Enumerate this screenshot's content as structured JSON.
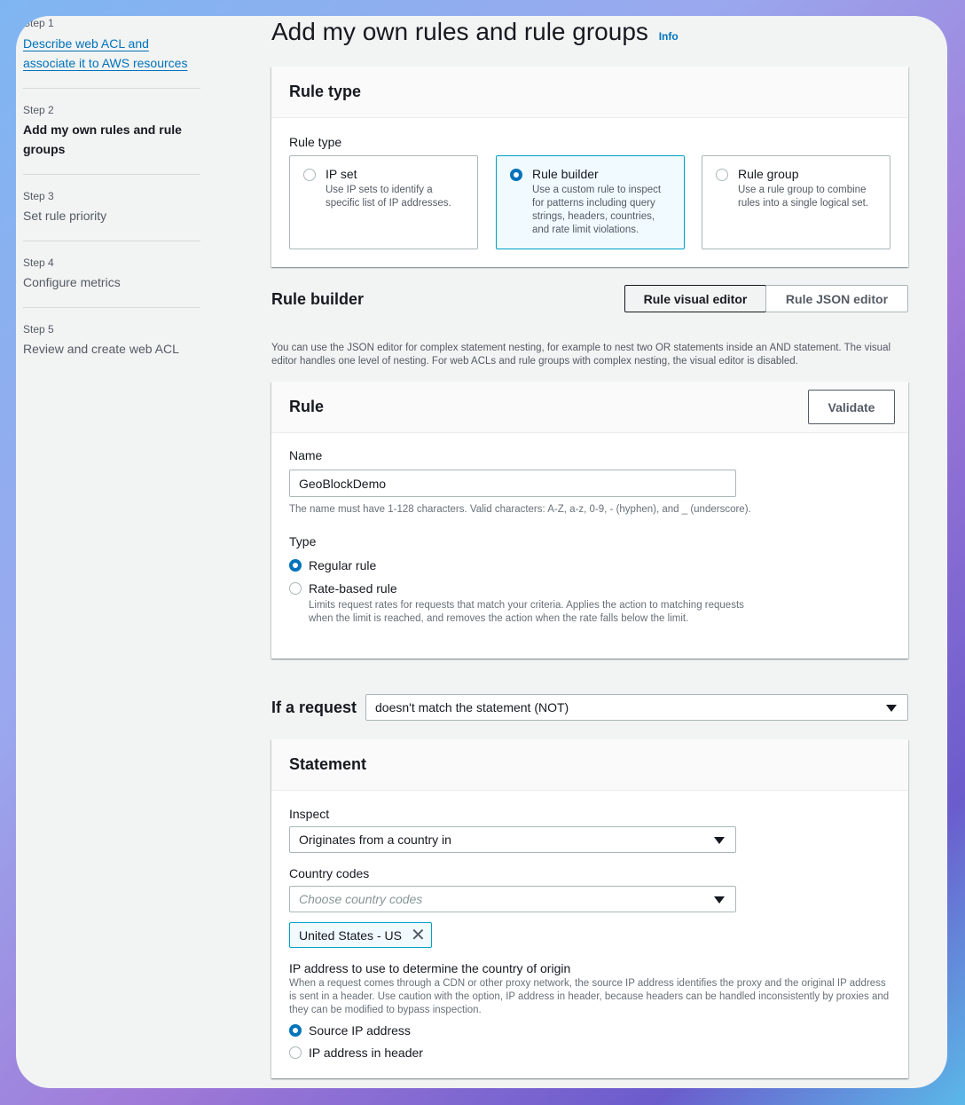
{
  "sidebar": {
    "steps": [
      {
        "num": "Step 1",
        "label": "Describe web ACL and associate it to AWS resources",
        "label_lines": [
          "Describe web ACL and",
          "associate it to AWS resources"
        ]
      },
      {
        "num": "Step 2",
        "label_lines": [
          "Add my own rules and rule",
          "groups"
        ]
      },
      {
        "num": "Step 3",
        "label": "Set rule priority"
      },
      {
        "num": "Step 4",
        "label": "Configure metrics"
      },
      {
        "num": "Step 5",
        "label": "Review and create web ACL"
      }
    ]
  },
  "page": {
    "title": "Add my own rules and rule groups",
    "info": "Info"
  },
  "rule_type": {
    "header": "Rule type",
    "label": "Rule type",
    "options": [
      {
        "title": "IP set",
        "desc": "Use IP sets to identify a specific list of IP addresses.",
        "selected": false
      },
      {
        "title": "Rule builder",
        "desc": "Use a custom rule to inspect for patterns including query strings, headers, countries, and rate limit violations.",
        "selected": true
      },
      {
        "title": "Rule group",
        "desc": "Use a rule group to combine rules into a single logical set.",
        "selected": false
      }
    ]
  },
  "rule_builder": {
    "title": "Rule builder",
    "visual_editor": "Rule visual editor",
    "json_editor": "Rule JSON editor",
    "active_editor": "Rule visual editor",
    "desc": "You can use the JSON editor for complex statement nesting, for example to nest two OR statements inside an AND statement. The visual editor handles one level of nesting. For web ACLs and rule groups with complex nesting, the visual editor is disabled."
  },
  "rule": {
    "header": "Rule",
    "validate": "Validate",
    "name_label": "Name",
    "name_value": "GeoBlockDemo",
    "name_hint": "The name must have 1-128 characters. Valid characters: A-Z, a-z, 0-9, - (hyphen), and _ (underscore).",
    "type_label": "Type",
    "types": [
      {
        "label": "Regular rule",
        "selected": true
      },
      {
        "label": "Rate-based rule",
        "selected": false,
        "desc": "Limits request rates for requests that match your criteria. Applies the action to matching requests when the limit is reached, and removes the action when the rate falls below the limit."
      }
    ]
  },
  "if_request": {
    "label": "If a request",
    "value": "doesn't match the statement (NOT)"
  },
  "statement": {
    "header": "Statement",
    "inspect_label": "Inspect",
    "inspect_value": "Originates from a country in",
    "country_label": "Country codes",
    "country_placeholder": "Choose country codes",
    "tokens": [
      "United States - US"
    ],
    "ip_label": "IP address to use to determine the country of origin",
    "ip_desc": "When a request comes through a CDN or other proxy network, the source IP address identifies the proxy and the original IP address is sent in a header. Use caution with the option, IP address in header, because headers can be handled inconsistently by proxies and they can be modified to bypass inspection.",
    "ip_options": [
      {
        "label": "Source IP address",
        "selected": true
      },
      {
        "label": "IP address in header",
        "selected": false
      }
    ]
  },
  "colors": {
    "accent": "#0073bb",
    "selected_tile_bg": "#f1faff",
    "selected_tile_border": "#00a1c9"
  }
}
